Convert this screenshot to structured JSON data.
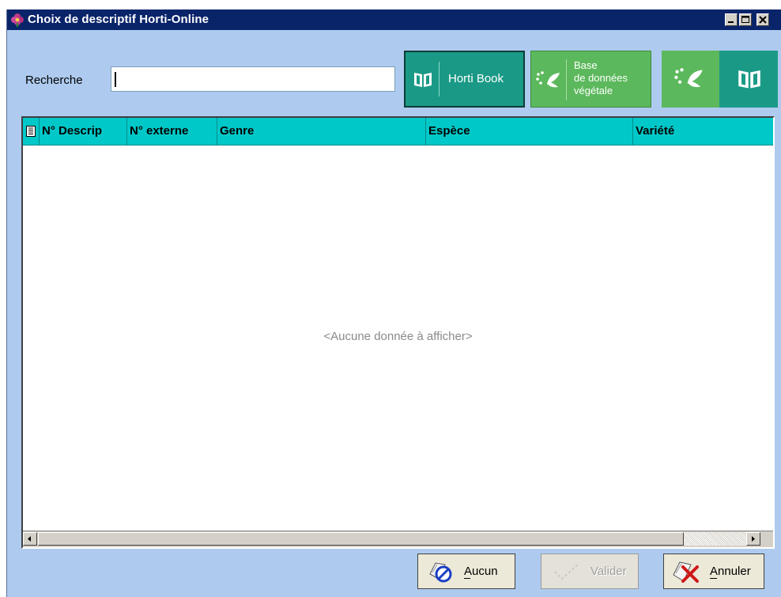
{
  "window": {
    "title": "Choix de descriptif Horti-Online"
  },
  "search": {
    "label": "Recherche",
    "value": ""
  },
  "toolbar": {
    "horti_book_label": "Horti Book",
    "plant_db_line1": "Base",
    "plant_db_line2": "de données",
    "plant_db_line3": "végétale"
  },
  "grid": {
    "columns": [
      "N° Descrip",
      "N° externe",
      "Genre",
      "Espèce",
      "Variété"
    ],
    "empty_message": "<Aucune donnée à afficher>"
  },
  "actions": {
    "none_label": "Aucun",
    "validate_label": "Valider",
    "cancel_label": "Annuler"
  },
  "colors": {
    "title_bar": "#0a246a",
    "window_bg": "#aecbef",
    "grid_header": "#00c8c8",
    "horti_book": "#1a9a86",
    "plant_db": "#5cb85c"
  }
}
